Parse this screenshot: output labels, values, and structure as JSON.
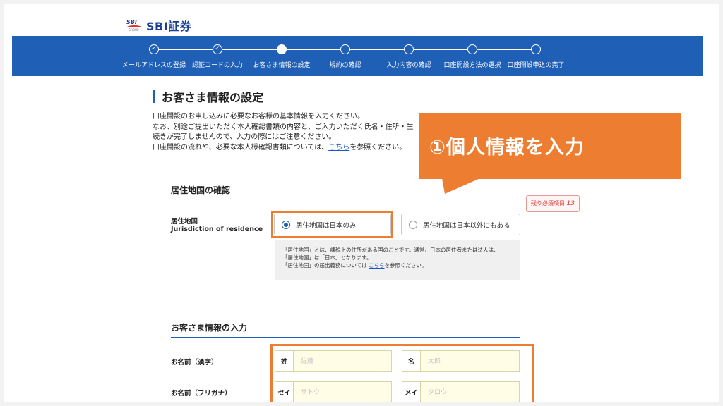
{
  "brand": {
    "mark_text": "SBI",
    "mark_group": "GROUP",
    "name": "SBI証券"
  },
  "steps": [
    {
      "label": "メールアドレスの登録",
      "state": "done"
    },
    {
      "label": "認証コードの入力",
      "state": "done"
    },
    {
      "label": "お客さま情報の設定",
      "state": "current"
    },
    {
      "label": "規約の確認",
      "state": "todo"
    },
    {
      "label": "入力内容の確認",
      "state": "todo"
    },
    {
      "label": "口座開設方法の選択",
      "state": "todo"
    },
    {
      "label": "口座開設申込の完了",
      "state": "todo"
    }
  ],
  "page": {
    "title": "お客さま情報の設定",
    "intro_line1": "口座開設のお申し込みに必要なお客様の基本情報を入力ください。",
    "intro_line2": "なお、別途ご提出いただく本人確認書類の内容と、ご入力いただく氏名・住所・生",
    "intro_line3": "続きが完了しませんので、入力の際にはご注意ください。",
    "intro_line4_pre": "口座開設の流れや、必要な本人様確認書類については、",
    "intro_line4_link": "こちら",
    "intro_line4_post": "を参照ください。"
  },
  "callout": {
    "text": "①個人情報を入力"
  },
  "residence": {
    "section_title": "居住地国の確認",
    "required_badge_text": "残り必須項目",
    "required_count": "13",
    "field_label": "居住地国",
    "field_label_en": "Jurisdiction of residence",
    "option_japan_only": "居住地国は日本のみ",
    "option_other": "居住地国は日本以外にもある",
    "selected": "japan_only",
    "note_line1": "「居住地国」とは、課税上の住所がある国のことです。通常、日本の居住者または法人は、",
    "note_line2": "「居住地国」は「日本」となります。",
    "note_line3_pre": "「居住地国」の届出義務については ",
    "note_line3_link": "こちら",
    "note_line3_post": "を参照ください。"
  },
  "customer": {
    "section_title": "お客さま情報の入力",
    "kanji_label": "お名前（漢字）",
    "kana_label": "お名前（フリガナ）",
    "last_prefix": "姓",
    "last_placeholder": "佐藤",
    "first_prefix": "名",
    "first_placeholder": "太郎",
    "last_kana_prefix": "セイ",
    "last_kana_placeholder": "サトウ",
    "first_kana_prefix": "メイ",
    "first_kana_placeholder": "タロウ"
  },
  "colors": {
    "accent_blue": "#1f5fb5",
    "highlight_orange": "#ed7d31",
    "input_bg": "#fffde6"
  }
}
